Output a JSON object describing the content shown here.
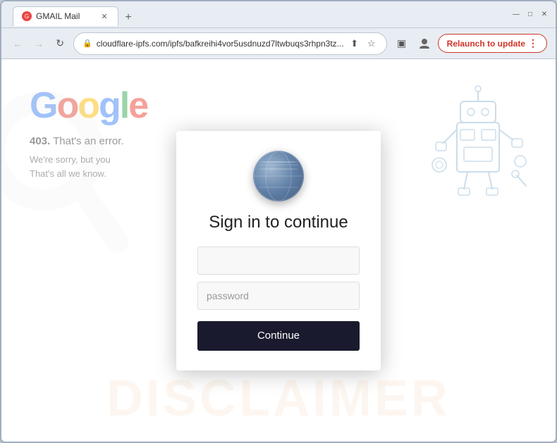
{
  "window": {
    "title": "GMAIL Mail",
    "controls": {
      "minimize": "—",
      "maximize": "□",
      "close": "✕"
    }
  },
  "tabs": [
    {
      "title": "GMAIL Mail",
      "active": true,
      "favicon": "G"
    }
  ],
  "new_tab_icon": "+",
  "nav": {
    "back": "←",
    "forward": "→",
    "reload": "↻",
    "url": "cloudflare-ipfs.com/ipfs/bafkreihi4vor5usdnuzd7ltwbuqs3rhpn3tz...",
    "lock_icon": "🔒",
    "share_icon": "⬆",
    "bookmark_icon": "☆",
    "sidebar_icon": "▣",
    "profile_icon": "👤",
    "relaunch_button": "Relaunch to update",
    "more_icon": "⋮"
  },
  "background_page": {
    "logo": "Google",
    "error_code": "403.",
    "error_text": "That's an error.",
    "error_detail_line1": "We're sorry, but you",
    "error_detail_line2": "That's all we know."
  },
  "modal": {
    "title": "Sign in to continue",
    "email_placeholder": "",
    "password_placeholder": "password",
    "button_label": "Continue"
  },
  "watermark": {
    "text": "DISCLAIMER"
  }
}
